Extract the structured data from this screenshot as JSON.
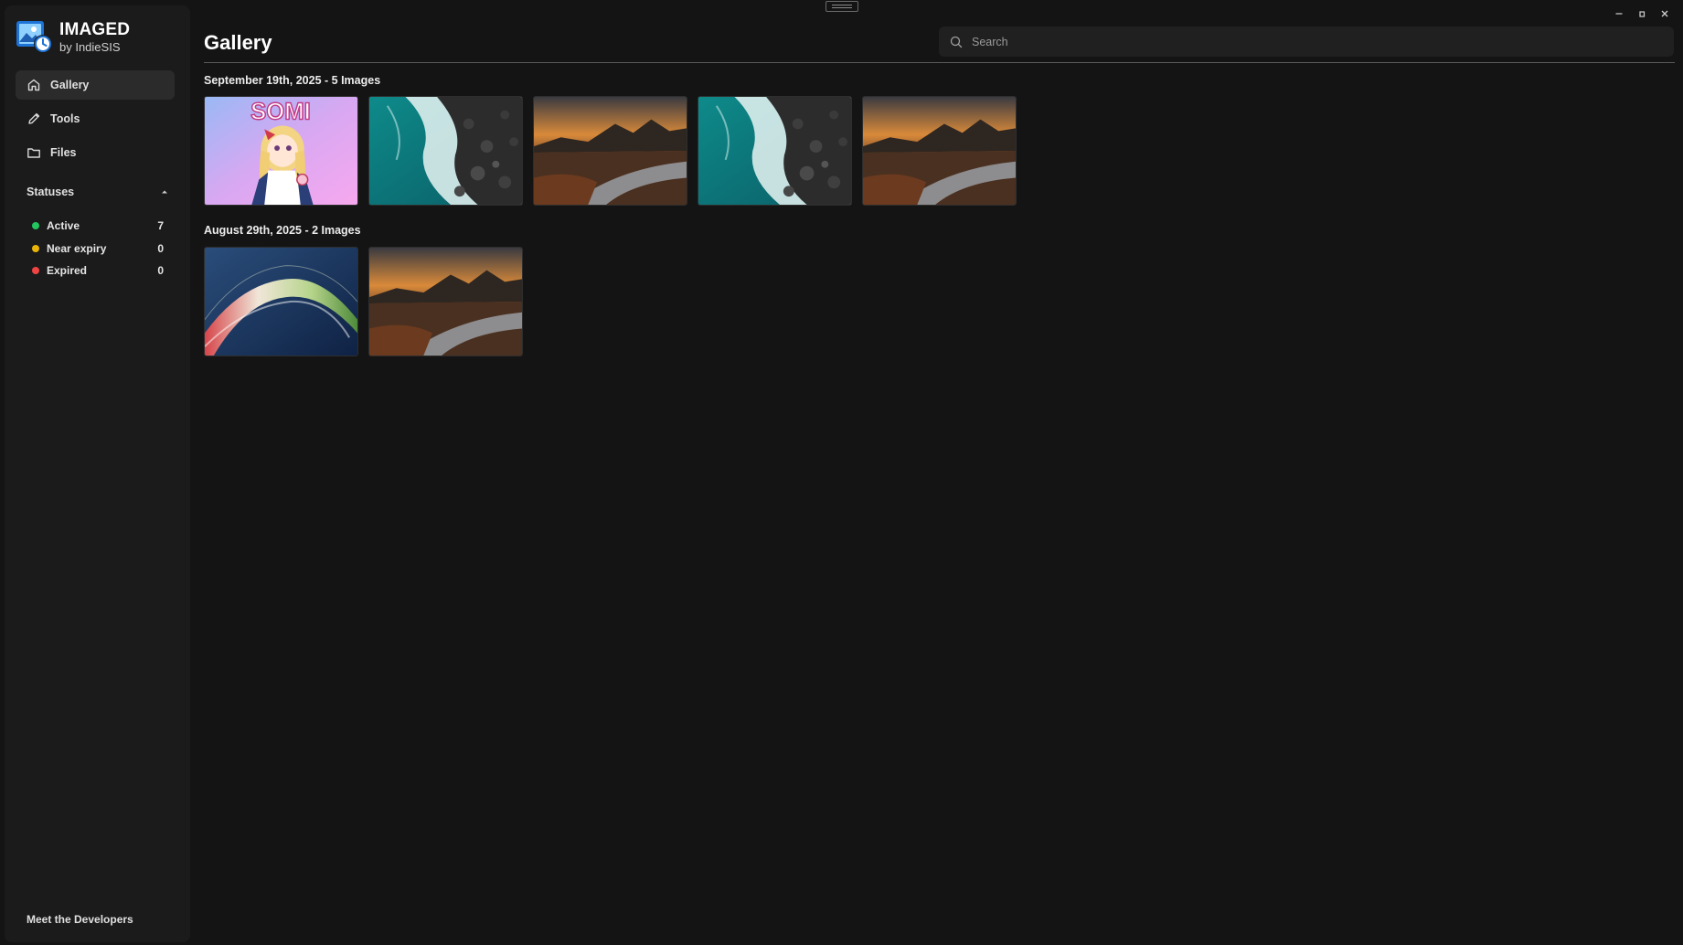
{
  "app": {
    "name": "IMAGED",
    "subtitle": "by IndieSIS"
  },
  "nav": [
    {
      "label": "Gallery",
      "icon": "home-icon",
      "active": true
    },
    {
      "label": "Tools",
      "icon": "pencil-icon",
      "active": false
    },
    {
      "label": "Files",
      "icon": "folder-icon",
      "active": false
    }
  ],
  "statuses": {
    "header": "Statuses",
    "items": [
      {
        "label": "Active",
        "count": "7",
        "color": "#22c55e"
      },
      {
        "label": "Near expiry",
        "count": "0",
        "color": "#eab308"
      },
      {
        "label": "Expired",
        "count": "0",
        "color": "#ef4444"
      }
    ]
  },
  "footer": {
    "meet_developers": "Meet the Developers"
  },
  "main": {
    "title": "Gallery",
    "search_placeholder": "Search",
    "groups": [
      {
        "title": "September 19th, 2025 - 5 Images",
        "images": [
          "anime-somi",
          "ocean-rocks",
          "sunset-coast",
          "ocean-rocks",
          "sunset-coast"
        ]
      },
      {
        "title": "August 29th, 2025 - 2 Images",
        "images": [
          "abstract-wave",
          "sunset-coast"
        ]
      }
    ]
  },
  "thumbnail_text": {
    "somi": "SOMI"
  }
}
